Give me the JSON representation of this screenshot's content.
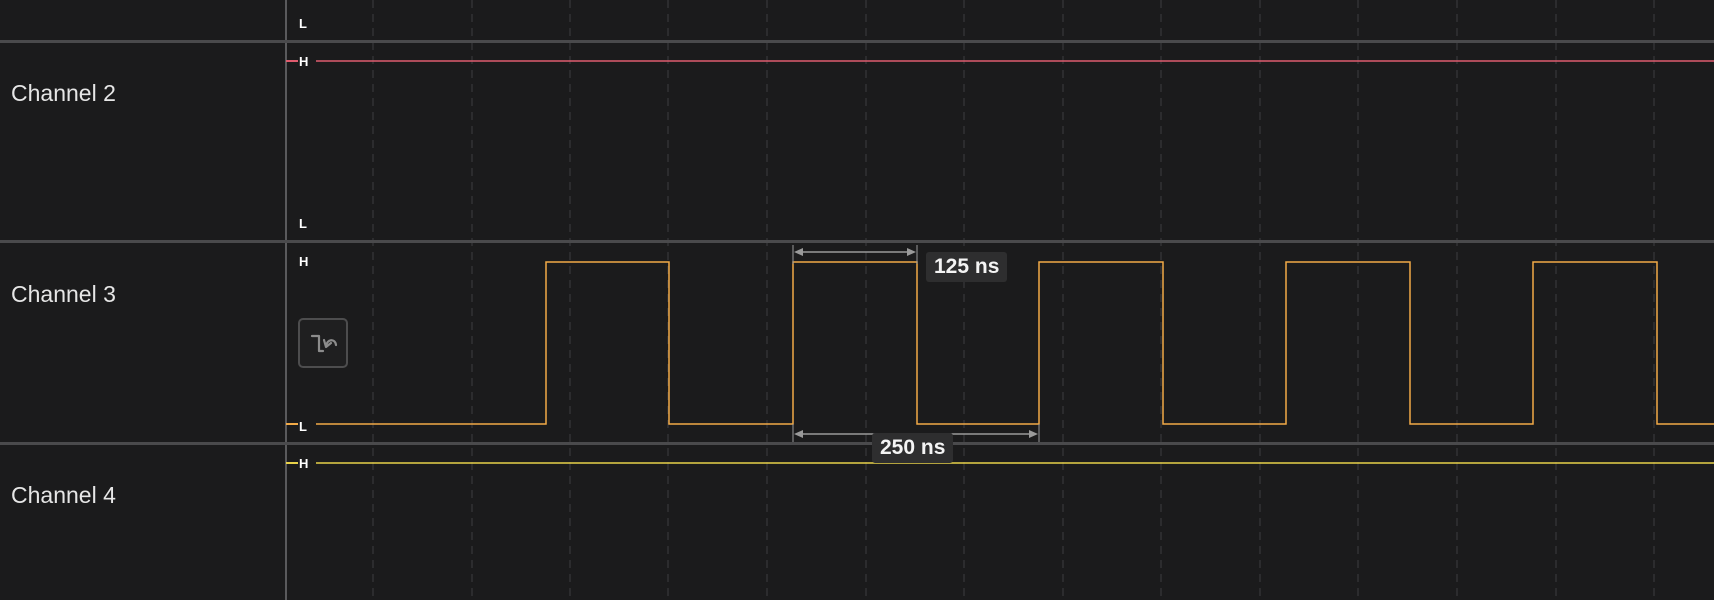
{
  "colors": {
    "background": "#1b1b1c",
    "separator": "#4a4a4c",
    "grid": "#3e3e40",
    "channel2": "#e05c6e",
    "channel3": "#f2aa47",
    "channel4": "#e8d24a",
    "measurement_arrow": "#9a9a9a"
  },
  "channels": [
    {
      "name": "Channel 2",
      "high_label": "H",
      "low_label": "L",
      "state": "high"
    },
    {
      "name": "Channel 3",
      "high_label": "H",
      "low_label": "L",
      "state": "clock"
    },
    {
      "name": "Channel 4",
      "high_label": "H",
      "state": "high"
    }
  ],
  "top_partial_channel": {
    "low_label": "L"
  },
  "measurements": {
    "pulse_width": "125 ns",
    "period": "250 ns"
  },
  "trigger_button": {
    "icon": "falling-edge-trigger-icon"
  }
}
